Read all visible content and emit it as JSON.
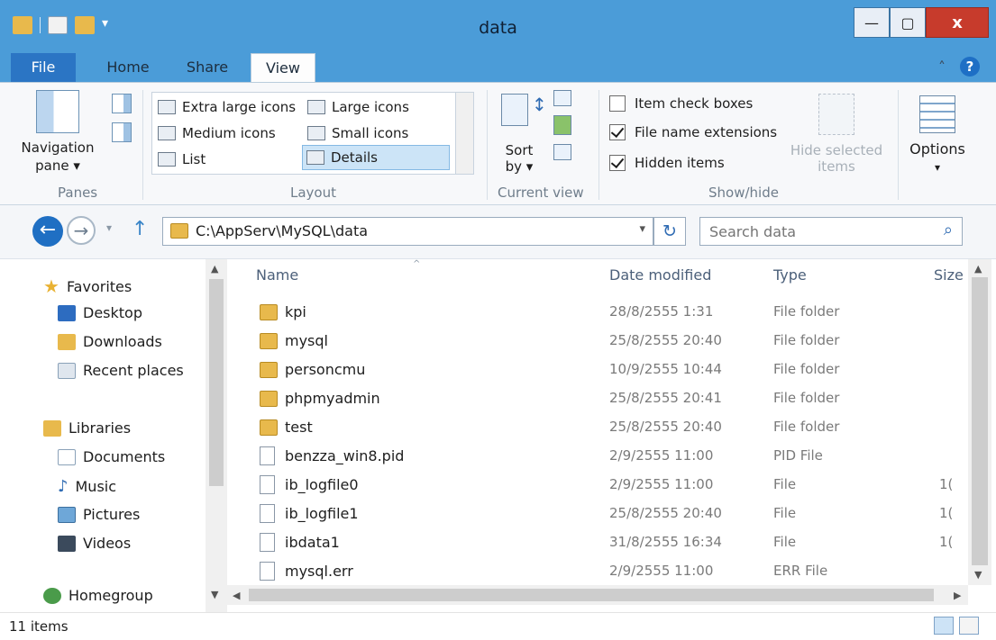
{
  "window": {
    "title": "data"
  },
  "ribbon_tabs": [
    "File",
    "Home",
    "Share",
    "View"
  ],
  "ribbon": {
    "panes": {
      "nav_label_1": "Navigation",
      "nav_label_2": "pane ▾",
      "group_label": "Panes"
    },
    "layout": {
      "items": [
        "Extra large icons",
        "Large icons",
        "Medium icons",
        "Small icons",
        "List",
        "Details"
      ],
      "selected": "Details",
      "group_label": "Layout"
    },
    "current_view": {
      "sort_label_1": "Sort",
      "sort_label_2": "by ▾",
      "group_label": "Current view"
    },
    "show_hide": {
      "item_check_boxes": "Item check boxes",
      "file_name_extensions": "File name extensions",
      "hidden_items": "Hidden items",
      "hide_selected_1": "Hide selected",
      "hide_selected_2": "items",
      "group_label": "Show/hide",
      "checked": {
        "item_check_boxes": false,
        "file_name_extensions": true,
        "hidden_items": true
      }
    },
    "options": {
      "label": "Options",
      "arrow": "▾"
    }
  },
  "address": {
    "path": "C:\\AppServ\\MySQL\\data",
    "search_placeholder": "Search data"
  },
  "nav_pane": {
    "favorites": {
      "label": "Favorites",
      "items": [
        "Desktop",
        "Downloads",
        "Recent places"
      ]
    },
    "libraries": {
      "label": "Libraries",
      "items": [
        "Documents",
        "Music",
        "Pictures",
        "Videos"
      ]
    },
    "homegroup": "Homegroup"
  },
  "columns": {
    "name": "Name",
    "date": "Date modified",
    "type": "Type",
    "size": "Size"
  },
  "files": [
    {
      "name": "kpi",
      "date": "28/8/2555 1:31",
      "type": "File folder",
      "size": "",
      "kind": "folder"
    },
    {
      "name": "mysql",
      "date": "25/8/2555 20:40",
      "type": "File folder",
      "size": "",
      "kind": "folder"
    },
    {
      "name": "personcmu",
      "date": "10/9/2555 10:44",
      "type": "File folder",
      "size": "",
      "kind": "folder"
    },
    {
      "name": "phpmyadmin",
      "date": "25/8/2555 20:41",
      "type": "File folder",
      "size": "",
      "kind": "folder"
    },
    {
      "name": "test",
      "date": "25/8/2555 20:40",
      "type": "File folder",
      "size": "",
      "kind": "folder"
    },
    {
      "name": "benzza_win8.pid",
      "date": "2/9/2555 11:00",
      "type": "PID File",
      "size": "",
      "kind": "file"
    },
    {
      "name": "ib_logfile0",
      "date": "2/9/2555 11:00",
      "type": "File",
      "size": "1(",
      "kind": "file"
    },
    {
      "name": "ib_logfile1",
      "date": "25/8/2555 20:40",
      "type": "File",
      "size": "1(",
      "kind": "file"
    },
    {
      "name": "ibdata1",
      "date": "31/8/2555 16:34",
      "type": "File",
      "size": "1(",
      "kind": "file"
    },
    {
      "name": "mysql.err",
      "date": "2/9/2555 11:00",
      "type": "ERR File",
      "size": "",
      "kind": "file"
    }
  ],
  "status": {
    "item_count": "11 items"
  },
  "colors": {
    "titlebar": "#4b9cd8",
    "file_tab": "#2b75c4",
    "close_button": "#c73b2c",
    "folder": "#e8b94c",
    "selection": "#cce4f7"
  },
  "icons": {
    "back": "←",
    "forward": "→",
    "up": "↑",
    "recent": "▾",
    "refresh": "↻",
    "search": "⌕",
    "minimize": "—",
    "maximize": "▢",
    "close": "x",
    "collapse": "˄",
    "help": "?",
    "dropdown": "▾",
    "scroll_up": "▲",
    "scroll_down": "▼",
    "scroll_left": "◀",
    "scroll_right": "▶",
    "sort_up": "^"
  }
}
